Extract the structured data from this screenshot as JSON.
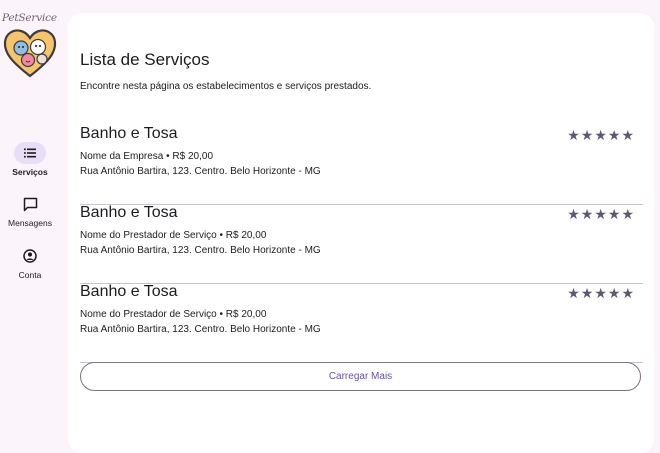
{
  "app": {
    "brand": "PetService"
  },
  "nav": {
    "items": [
      {
        "label": "Serviços",
        "icon": "list-icon",
        "active": true
      },
      {
        "label": "Mensagens",
        "icon": "chat-icon",
        "active": false
      },
      {
        "label": "Conta",
        "icon": "account-icon",
        "active": false
      }
    ]
  },
  "main": {
    "title": "Lista de Serviços",
    "subtitle": "Encontre nesta página os estabelecimentos e serviços prestados.",
    "items": [
      {
        "title": "Banho e Tosa",
        "stars": "★★★★★",
        "line1": "Nome da Empresa • R$ 20,00",
        "line2": "Rua Antônio Bartira, 123. Centro. Belo Horizonte - MG"
      },
      {
        "title": "Banho e Tosa",
        "stars": "★★★★★",
        "line1": "Nome do Prestador de Serviço • R$ 20,00",
        "line2": "Rua Antônio Bartira, 123. Centro. Belo Horizonte - MG"
      },
      {
        "title": "Banho e Tosa",
        "stars": "★★★★★",
        "line1": "Nome do Prestador de Serviço • R$ 20,00",
        "line2": "Rua Antônio Bartira, 123. Centro. Belo Horizonte - MG"
      }
    ],
    "load_more": "Carregar Mais"
  },
  "colors": {
    "background": "#fcf4fb",
    "card": "#ffffff",
    "accent": "#6750a4",
    "active_indicator": "#e8def8",
    "stars": "#5f5873",
    "divider": "#cac4d0"
  }
}
